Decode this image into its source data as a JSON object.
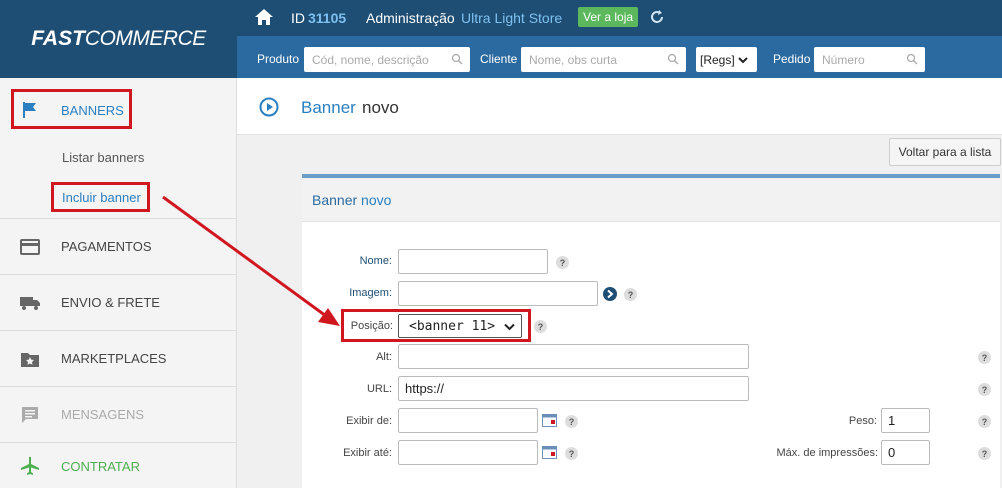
{
  "logo": {
    "fast": "FAST",
    "commerce": "COMMERCE"
  },
  "topbar": {
    "id_label": "ID",
    "id_value": "31105",
    "admin_label": "Administração",
    "store_name": "Ultra Light Store",
    "view_store_button": "Ver a loja"
  },
  "searchbar": {
    "product_label": "Produto",
    "product_placeholder": "Cód, nome, descrição",
    "client_label": "Cliente",
    "client_placeholder": "Nome, obs curta",
    "regs_value": "[Regs]",
    "order_label": "Pedido",
    "order_placeholder": "Número"
  },
  "sidebar": {
    "banners": "BANNERS",
    "list_banners": "Listar banners",
    "include_banner": "Incluir banner",
    "payments": "PAGAMENTOS",
    "shipping": "ENVIO & FRETE",
    "marketplaces": "MARKETPLACES",
    "messages": "MENSAGENS",
    "hire": "CONTRATAR"
  },
  "page": {
    "title_word1": "Banner",
    "title_word2": "novo",
    "back_button": "Voltar para a lista",
    "panel_title_word1": "Banner",
    "panel_title_word2": "novo"
  },
  "form": {
    "name_label": "Nome:",
    "name_value": "",
    "image_label": "Imagem:",
    "image_value": "",
    "position_label": "Posição:",
    "position_value": "<banner 11>",
    "alt_label": "Alt:",
    "alt_value": "",
    "url_label": "URL:",
    "url_value": "https://",
    "show_from_label": "Exibir de:",
    "show_from_value": "",
    "show_until_label": "Exibir até:",
    "show_until_value": "",
    "weight_label": "Peso:",
    "weight_value": "1",
    "max_impressions_label": "Máx. de impressões:",
    "max_impressions_value": "0",
    "help_symbol": "?"
  },
  "colors": {
    "header_dark": "#1f4e74",
    "header_mid": "#2a6aa0",
    "accent_blue": "#2a7fc1",
    "highlight_red": "#d0171f",
    "green_badge": "#5cb85c",
    "hire_green": "#4caf50"
  },
  "icons": {
    "home": "home-icon",
    "refresh": "refresh-icon",
    "flag": "flag-icon",
    "card": "credit-card-icon",
    "truck": "truck-icon",
    "star_folder": "marketplace-star-icon",
    "message": "message-icon",
    "plane": "airplane-icon",
    "play_circle": "play-circle-icon",
    "arrow_circle": "arrow-right-circle-icon",
    "calendar": "calendar-icon",
    "search": "search-icon",
    "help": "help-icon"
  }
}
